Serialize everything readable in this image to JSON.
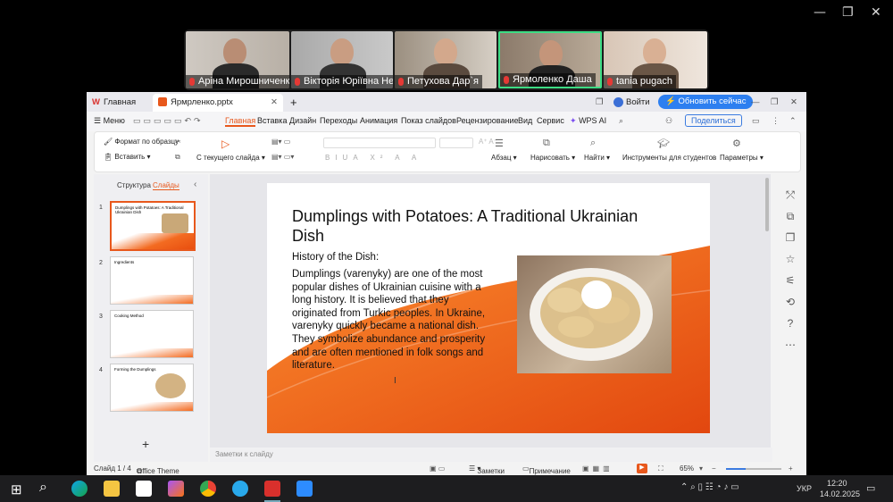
{
  "window_controls": {
    "minimize": "—",
    "maximize": "❐",
    "close": "✕"
  },
  "participants": [
    {
      "name": "Аріна Мирошниченко",
      "muted": true
    },
    {
      "name": "Вікторія Юріївна Несте...",
      "muted": true
    },
    {
      "name": "Петухова Дар`я",
      "muted": true
    },
    {
      "name": "Ярмоленко Даша",
      "muted": true,
      "active": true
    },
    {
      "name": "tania pugach",
      "muted": true
    }
  ],
  "wps": {
    "tabs": {
      "home": "Главная",
      "file": "Ярмрленко.pptx",
      "new": "+"
    },
    "account": {
      "login": "Войти",
      "update": "Обновить сейчас"
    },
    "menu": {
      "menu_label": "Меню",
      "items": [
        "Главная",
        "Вставка",
        "Дизайн",
        "Переходы",
        "Анимация",
        "Показ слайдов",
        "Рецензирование",
        "Вид",
        "Сервис"
      ],
      "wps_ai": "WPS AI",
      "share": "Поделиться"
    },
    "ribbon": {
      "format_painter": "Формат по образцу",
      "paste": "Вставить",
      "from_current": "С текущего слайда",
      "paragraph": "Абзац",
      "draw": "Нарисовать",
      "find": "Найти",
      "student_tools": "Инструменты для студентов",
      "settings": "Параметры",
      "font_buttons": [
        "B",
        "I",
        "U",
        "A",
        "X²",
        "A",
        "A",
        "A"
      ]
    },
    "sidepanel": {
      "structure": "Структура",
      "slides": "Слайды",
      "add": "+"
    },
    "thumbnails": [
      {
        "num": "1",
        "title": "Dumplings with Potatoes: A Traditional Ukrainian Dish"
      },
      {
        "num": "2",
        "title": "Ingredients"
      },
      {
        "num": "3",
        "title": "Cooking Method"
      },
      {
        "num": "4",
        "title": "Forming the Dumplings"
      }
    ],
    "slide": {
      "title": "Dumplings with Potatoes: A Traditional Ukrainian Dish",
      "subtitle": "History of the Dish:",
      "body": "Dumplings (varenyky) are one of the most popular dishes of Ukrainian cuisine with a long history. It is believed that they originated from Turkic peoples. In Ukraine, varenyky quickly became a national dish. They symbolize abundance and prosperity and are often mentioned in folk songs and literature."
    },
    "notes_placeholder": "Заметки к слайду",
    "status": {
      "slide_counter": "Слайд 1 / 4",
      "theme": "Office Theme",
      "notes": "Заметки",
      "comment": "Примечание",
      "zoom": "65%"
    }
  },
  "taskbar": {
    "language": "УКР",
    "time": "12:20",
    "date": "14.02.2025"
  },
  "colors": {
    "accent_orange": "#e8581c",
    "wps_blue": "#1e88e5"
  }
}
